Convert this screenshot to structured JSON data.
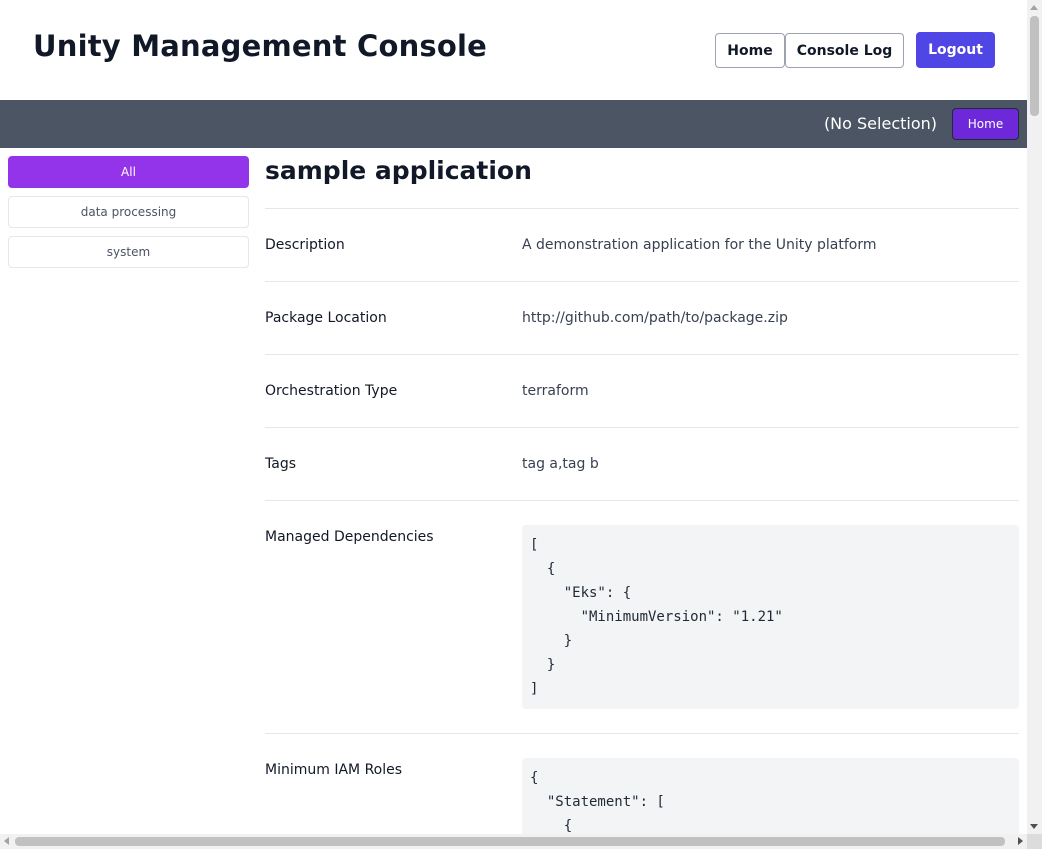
{
  "header": {
    "title": "Unity Management Console",
    "nav": {
      "home_label": "Home",
      "console_log_label": "Console Log",
      "logout_label": "Logout"
    }
  },
  "subbar": {
    "selection_text": "(No Selection)",
    "home_label": "Home"
  },
  "sidebar": {
    "items": [
      {
        "label": "All",
        "active": true
      },
      {
        "label": "data processing",
        "active": false
      },
      {
        "label": "system",
        "active": false
      }
    ]
  },
  "main": {
    "app_name": "sample application",
    "fields": {
      "description": {
        "label": "Description",
        "value": "A demonstration application for the Unity platform"
      },
      "package_location": {
        "label": "Package Location",
        "value": "http://github.com/path/to/package.zip"
      },
      "orchestration_type": {
        "label": "Orchestration Type",
        "value": "terraform"
      },
      "tags": {
        "label": "Tags",
        "value": "tag a,tag b"
      },
      "managed_dependencies": {
        "label": "Managed Dependencies",
        "value": "[\n  {\n    \"Eks\": {\n      \"MinimumVersion\": \"1.21\"\n    }\n  }\n]"
      },
      "minimum_iam_roles": {
        "label": "Minimum IAM Roles",
        "value": "{\n  \"Statement\": [\n    {"
      }
    }
  },
  "colors": {
    "primary": "#4f46e5",
    "purple": "#6d28d9",
    "sidebar_active": "#9333ea",
    "subbar": "#4b5563"
  }
}
